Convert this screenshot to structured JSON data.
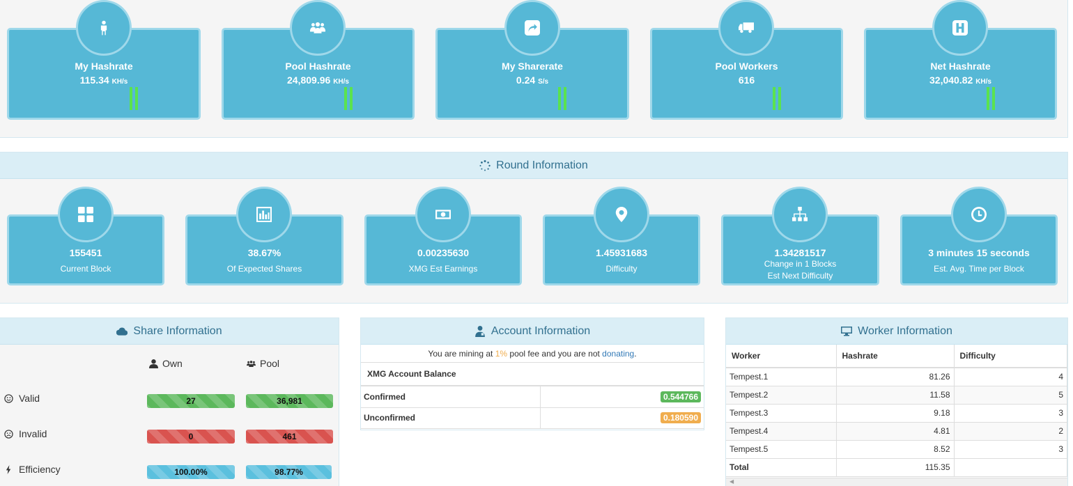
{
  "stats": [
    {
      "title": "My Hashrate",
      "value": "115.34",
      "unit": "KH/s",
      "icon": "male-icon"
    },
    {
      "title": "Pool Hashrate",
      "value": "24,809.96",
      "unit": "KH/s",
      "icon": "users-icon"
    },
    {
      "title": "My Sharerate",
      "value": "0.24",
      "unit": "S/s",
      "icon": "share-icon"
    },
    {
      "title": "Pool Workers",
      "value": "616",
      "unit": "",
      "icon": "truck-icon"
    },
    {
      "title": "Net Hashrate",
      "value": "32,040.82",
      "unit": "KH/s",
      "icon": "h-square-icon"
    }
  ],
  "round": {
    "title": "Round Information",
    "cards": [
      {
        "value": "155451",
        "label": "Current Block",
        "icon": "th-large-icon"
      },
      {
        "value": "38.67%",
        "label": "Of Expected Shares",
        "icon": "bar-chart-icon"
      },
      {
        "value": "0.00235630",
        "label": "XMG Est Earnings",
        "icon": "money-icon"
      },
      {
        "value": "1.45931683",
        "label": "Difficulty",
        "icon": "map-marker-icon"
      },
      {
        "value": "1.34281517",
        "label": "Change in 1 Blocks",
        "label2": "Est Next Difficulty",
        "icon": "sitemap-icon"
      },
      {
        "value": "3 minutes 15 seconds",
        "label": "Est. Avg. Time per Block",
        "icon": "clock-icon"
      }
    ]
  },
  "share": {
    "title": "Share Information",
    "own_label": "Own",
    "pool_label": "Pool",
    "rows": [
      {
        "label": "Valid",
        "own": "27",
        "pool": "36,981",
        "color": "#5cb85c"
      },
      {
        "label": "Invalid",
        "own": "0",
        "pool": "461",
        "color": "#d9534f"
      },
      {
        "label": "Efficiency",
        "own": "100.00%",
        "pool": "98.77%",
        "color": "#5bc0de"
      }
    ]
  },
  "account": {
    "title": "Account Information",
    "note_prefix": "You are mining at ",
    "fee": "1%",
    "note_mid": " pool fee and you are not ",
    "donating": "donating",
    "note_end": ".",
    "balance_title": "XMG Account Balance",
    "confirmed_label": "Confirmed",
    "confirmed_value": "0.544766",
    "unconfirmed_label": "Unconfirmed",
    "unconfirmed_value": "0.180590"
  },
  "workers": {
    "title": "Worker Information",
    "columns": [
      "Worker",
      "Hashrate",
      "Difficulty"
    ],
    "rows": [
      {
        "name": "Tempest.1",
        "hashrate": "81.26",
        "difficulty": "4"
      },
      {
        "name": "Tempest.2",
        "hashrate": "11.58",
        "difficulty": "5"
      },
      {
        "name": "Tempest.3",
        "hashrate": "9.18",
        "difficulty": "3"
      },
      {
        "name": "Tempest.4",
        "hashrate": "4.81",
        "difficulty": "2"
      },
      {
        "name": "Tempest.5",
        "hashrate": "8.52",
        "difficulty": "3"
      }
    ],
    "total_label": "Total",
    "total_hashrate": "115.35"
  },
  "colors": {
    "card": "#56b8d6",
    "card_border": "#9fd8ea",
    "spark": "#5be34e",
    "panel_head": "#daeef6"
  }
}
